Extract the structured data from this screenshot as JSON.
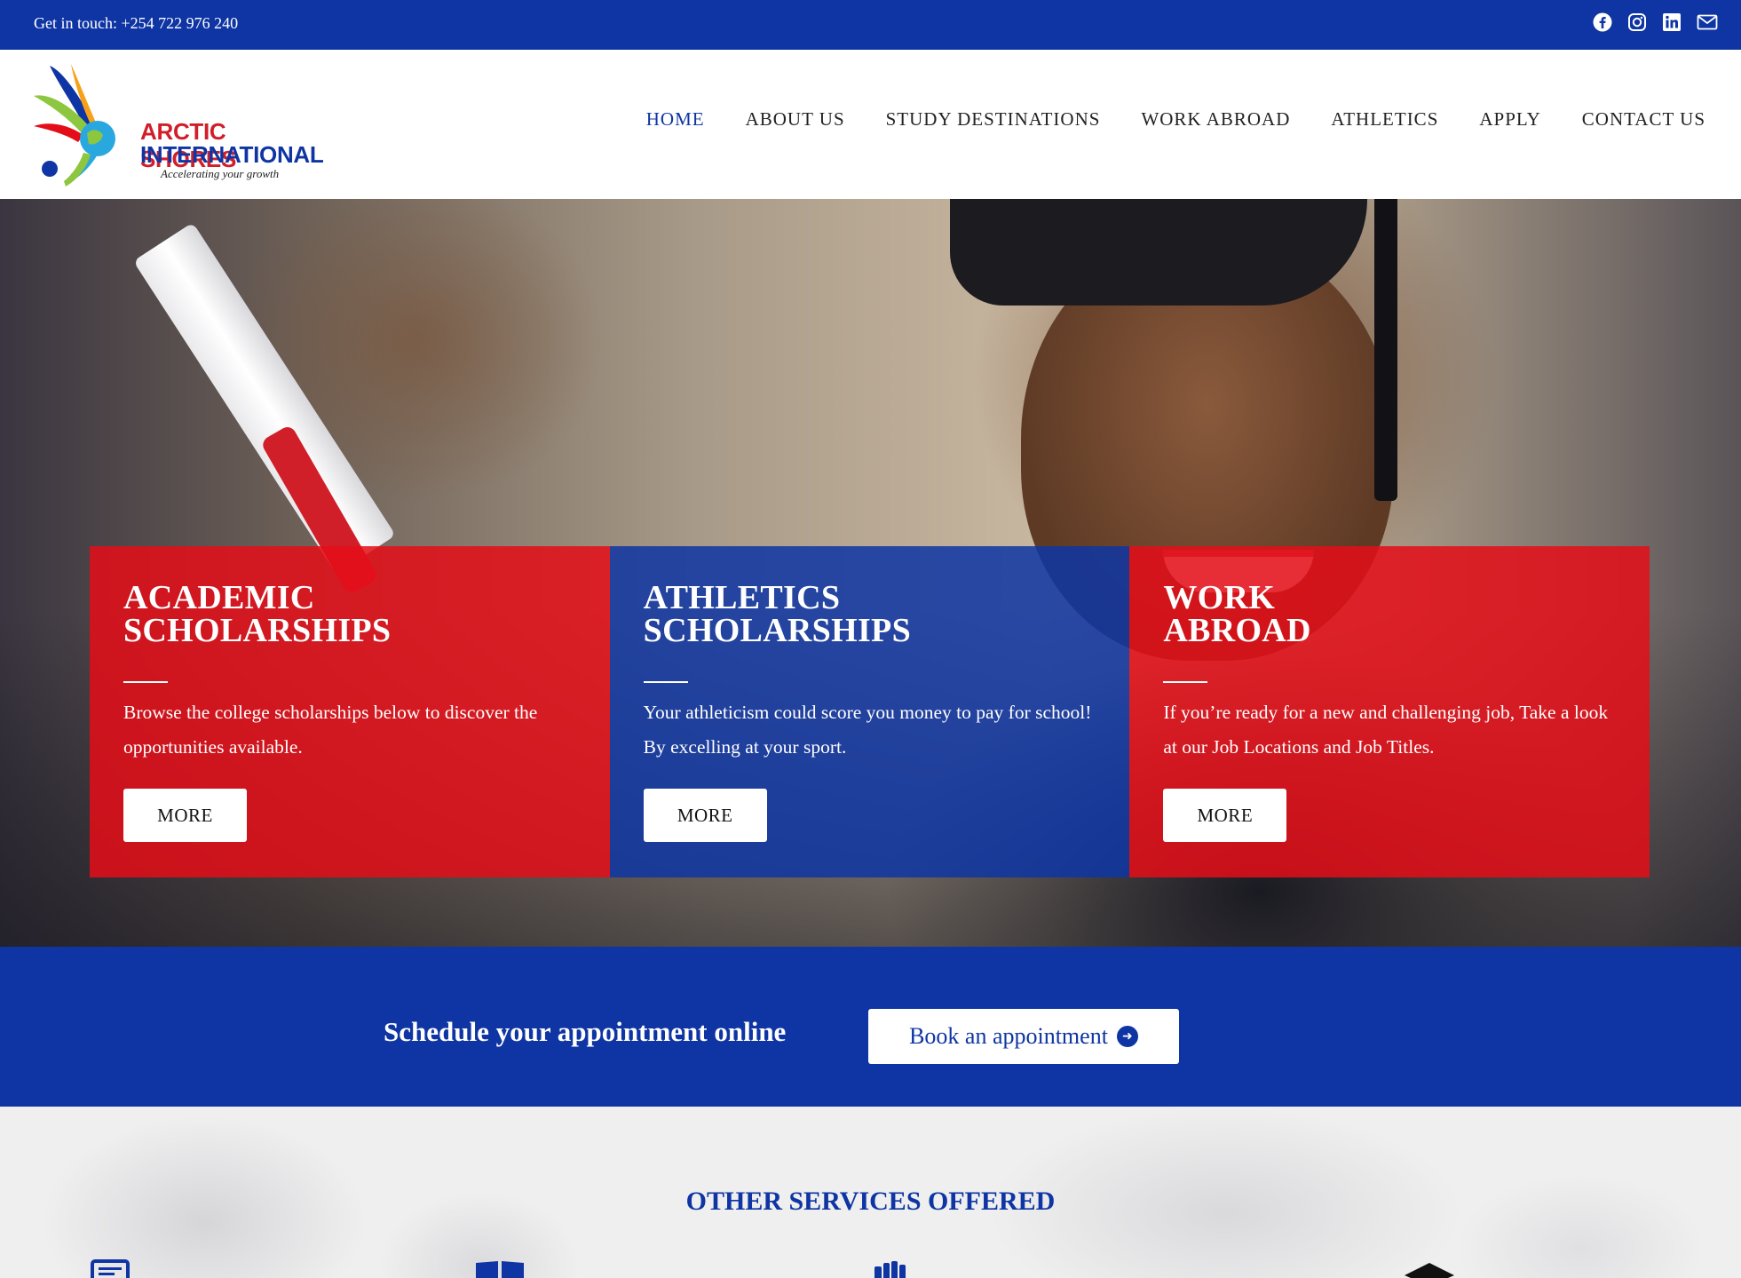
{
  "topbar": {
    "contact": "Get in touch: +254 722 976 240",
    "social": [
      "facebook-icon",
      "instagram-icon",
      "linkedin-icon",
      "mail-icon"
    ]
  },
  "logo": {
    "line1": "ARCTIC SHORES",
    "line2": "INTERNATIONAL",
    "tagline": "Accelerating your growth"
  },
  "nav": {
    "items": [
      {
        "label": "HOME",
        "active": true
      },
      {
        "label": "ABOUT US"
      },
      {
        "label": "STUDY DESTINATIONS"
      },
      {
        "label": "WORK ABROAD"
      },
      {
        "label": "ATHLETICS"
      },
      {
        "label": "APPLY"
      },
      {
        "label": "CONTACT US"
      }
    ]
  },
  "cards": [
    {
      "title_line1": "ACADEMIC",
      "title_line2": "SCHOLARSHIPS",
      "text": "Browse the college scholarships below to discover the opportunities available.",
      "button": "MORE",
      "color": "#e40e18"
    },
    {
      "title_line1": "ATHLETICS",
      "title_line2": "SCHOLARSHIPS",
      "text": "Your athleticism could score you money to pay for school! By excelling at your sport.",
      "button": "MORE",
      "color": "#0e35a3"
    },
    {
      "title_line1": "WORK",
      "title_line2": "ABROAD",
      "text": "If you’re ready for a new and challenging job, Take a look at our  Job Locations and Job Titles.",
      "button": "MORE",
      "color": "#e40e18"
    }
  ],
  "appointment": {
    "text": "Schedule your appointment online",
    "button": "Book an appointment"
  },
  "services": {
    "heading": "OTHER SERVICES OFFERED",
    "icons": [
      "document-icon",
      "book-icon",
      "fist-icon",
      "graduation-cap-icon"
    ]
  },
  "colors": {
    "brand_blue": "#0e35a3",
    "brand_red": "#e40e18"
  }
}
